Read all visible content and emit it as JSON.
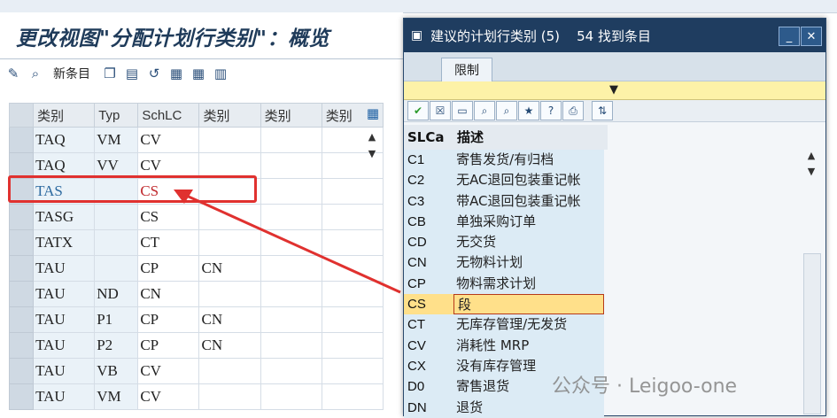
{
  "main": {
    "title": "更改视图\"分配计划行类别\"：概览",
    "toolbar": {
      "new_entries": "新条目"
    },
    "grid": {
      "headers": [
        "类别",
        "Typ",
        "SchLC",
        "类别",
        "类别",
        "类别"
      ],
      "rows": [
        [
          "TAQ",
          "VM",
          "CV",
          "",
          "",
          ""
        ],
        [
          "TAQ",
          "VV",
          "CV",
          "",
          "",
          ""
        ],
        [
          "TAS",
          "",
          "CS",
          "",
          "",
          ""
        ],
        [
          "TASG",
          "",
          "CS",
          "",
          "",
          ""
        ],
        [
          "TATX",
          "",
          "CT",
          "",
          "",
          ""
        ],
        [
          "TAU",
          "",
          "CP",
          "CN",
          "",
          ""
        ],
        [
          "TAU",
          "ND",
          "CN",
          "",
          "",
          ""
        ],
        [
          "TAU",
          "P1",
          "CP",
          "CN",
          "",
          ""
        ],
        [
          "TAU",
          "P2",
          "CP",
          "CN",
          "",
          ""
        ],
        [
          "TAU",
          "VB",
          "CV",
          "",
          "",
          ""
        ],
        [
          "TAU",
          "VM",
          "CV",
          "",
          "",
          ""
        ]
      ]
    }
  },
  "dialog": {
    "title": "建议的计划行类别 (5)    54 找到条目",
    "tab": "限制",
    "columns": {
      "key": "SLCa",
      "desc": "描述"
    },
    "items": [
      {
        "key": "C1",
        "desc": "寄售发货/有归档"
      },
      {
        "key": "C2",
        "desc": "无AC退回包装重记帐"
      },
      {
        "key": "C3",
        "desc": "带AC退回包装重记帐"
      },
      {
        "key": "CB",
        "desc": "单独采购订单"
      },
      {
        "key": "CD",
        "desc": "无交货"
      },
      {
        "key": "CN",
        "desc": "无物料计划"
      },
      {
        "key": "CP",
        "desc": "物料需求计划"
      },
      {
        "key": "CS",
        "desc": "段"
      },
      {
        "key": "CT",
        "desc": "无库存管理/无发货"
      },
      {
        "key": "CV",
        "desc": "消耗性 MRP"
      },
      {
        "key": "CX",
        "desc": "没有库存管理"
      },
      {
        "key": "D0",
        "desc": "寄售退货"
      },
      {
        "key": "DN",
        "desc": "退货"
      }
    ],
    "active_index": 7
  },
  "watermark": "公众号 · Leigoo-one",
  "colors": {
    "highlight_red": "#e0312f",
    "dialog_title": "#1f3d60",
    "active_row": "#ffe08a"
  }
}
